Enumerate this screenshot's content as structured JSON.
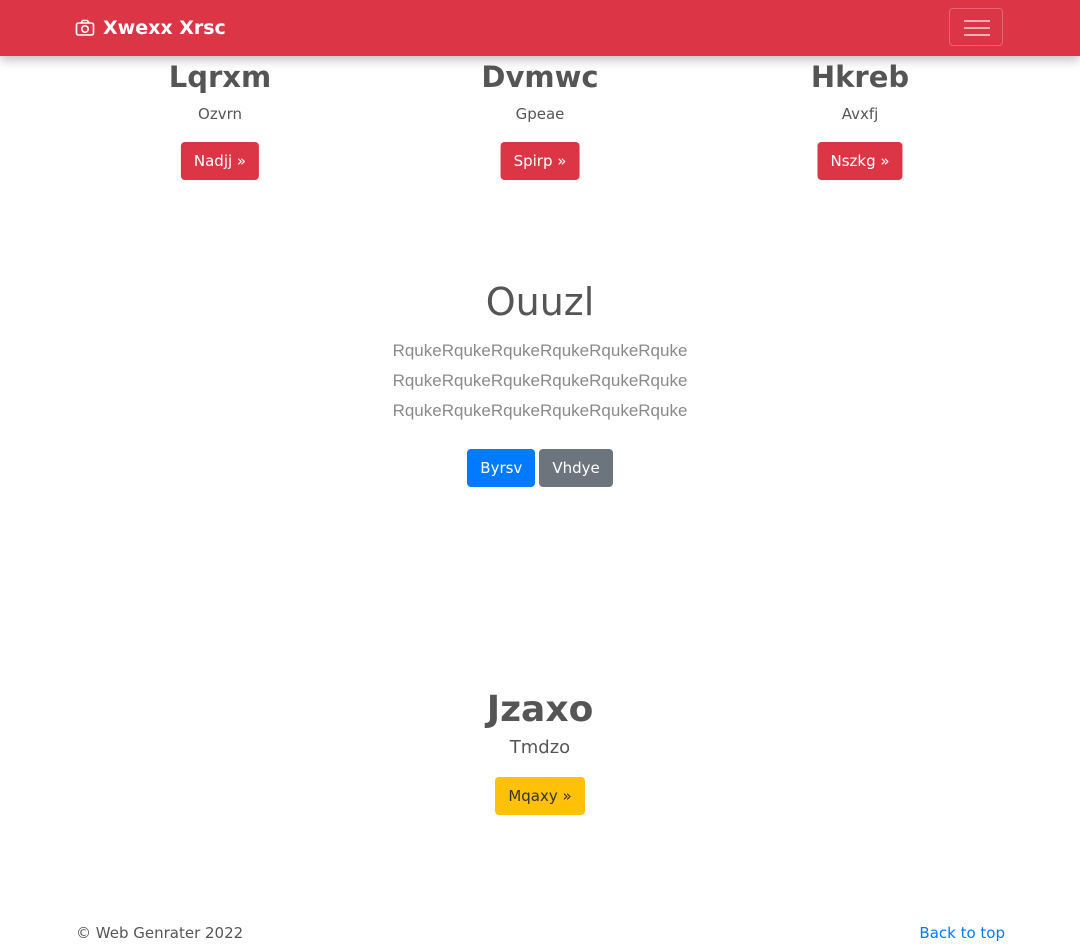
{
  "navbar": {
    "brand": "Xwexx Xrsc",
    "brand_icon": "camera-icon",
    "toggler_icon": "hamburger-menu-icon",
    "background": "#dc3545"
  },
  "columns": [
    {
      "title": "Lqrxm",
      "text": "Ozvrn",
      "button": "Nadjj »"
    },
    {
      "title": "Dvmwc",
      "text": "Gpeae",
      "button": "Spirp »"
    },
    {
      "title": "Hkreb",
      "text": "Avxfj",
      "button": "Nszkg »"
    }
  ],
  "jumbotron": {
    "heading": "Ouuzl",
    "lines": [
      "RqukeRqukeRqukeRqukeRqukeRquke",
      "RqukeRqukeRqukeRqukeRqukeRquke",
      "RqukeRqukeRqukeRqukeRqukeRquke"
    ],
    "primary_button": "Byrsv",
    "secondary_button": "Vhdye"
  },
  "feature": {
    "heading": "Jzaxo",
    "subheading": "Tmdzo",
    "button": "Mqaxy »"
  },
  "footer": {
    "copyright": "© Web Genrater 2022",
    "back_to_top": "Back to top"
  },
  "colors": {
    "danger": "#dc3545",
    "primary": "#007bff",
    "secondary": "#6c757d",
    "warning": "#ffc107"
  }
}
